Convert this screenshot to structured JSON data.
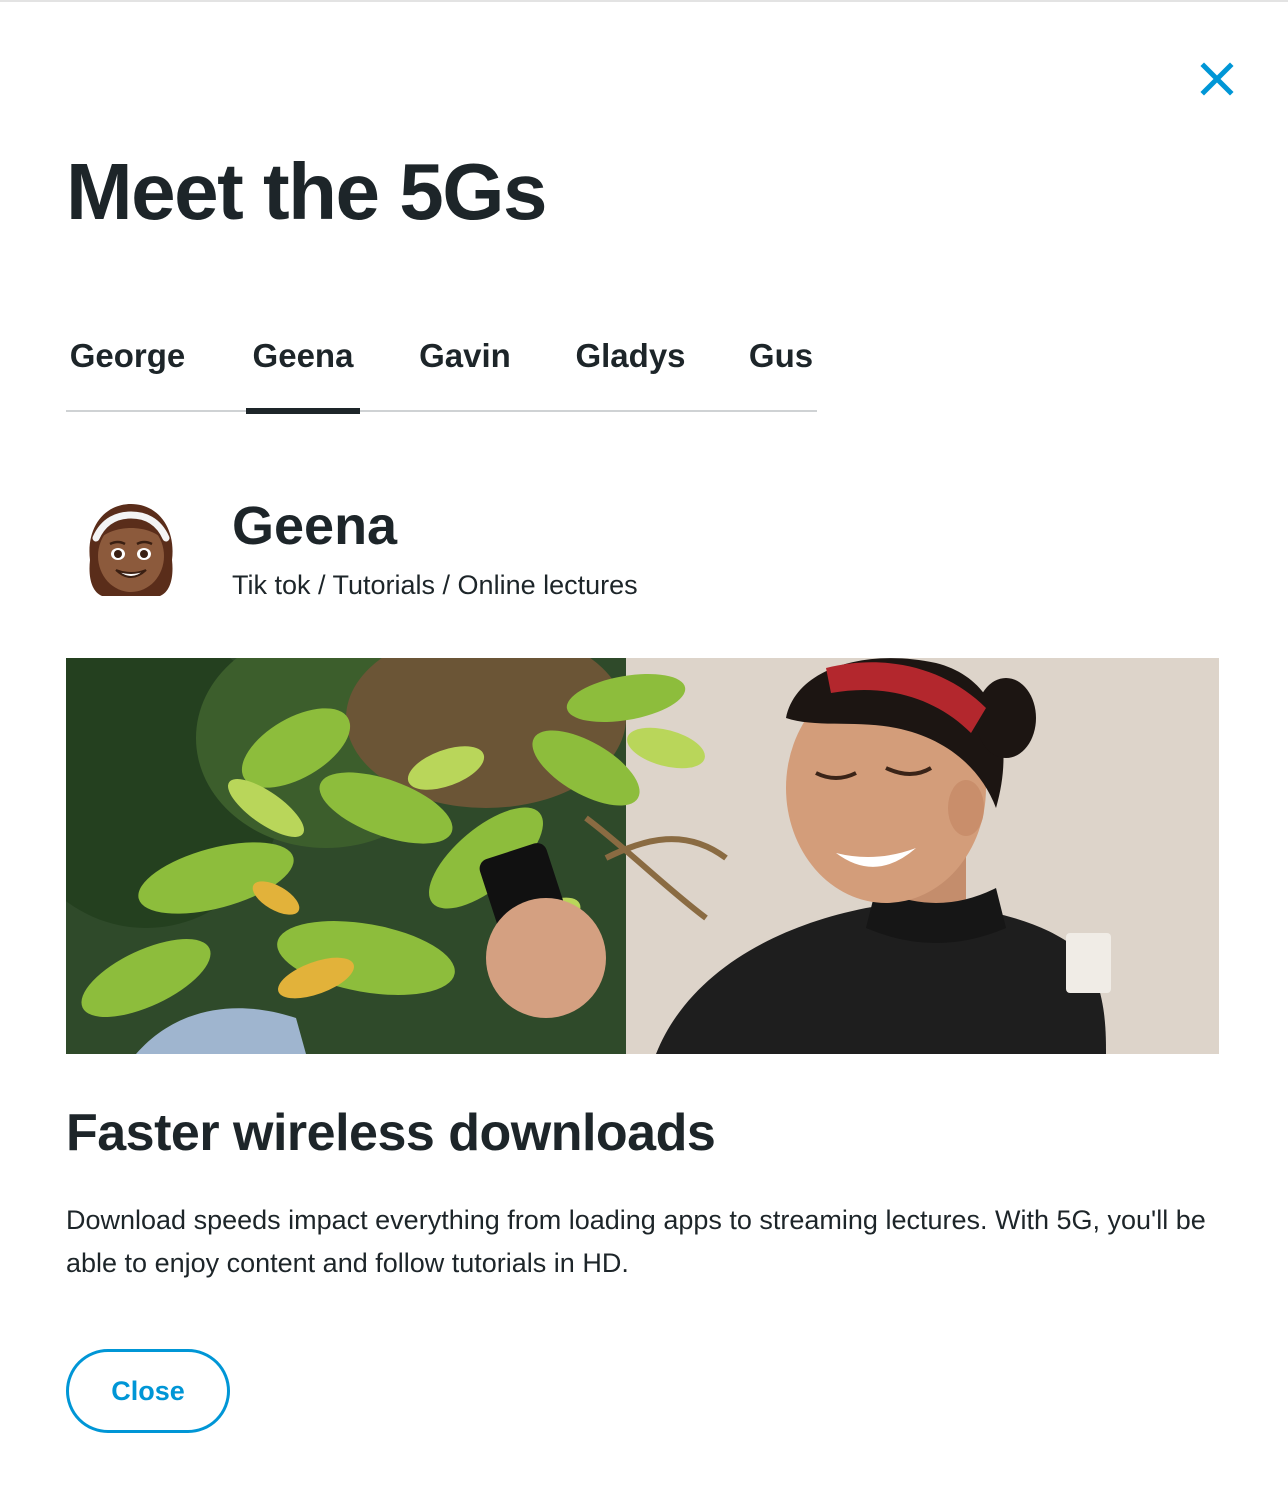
{
  "modal": {
    "title": "Meet the 5Gs",
    "close_icon": "close-icon",
    "accent_color": "#0096d6",
    "text_color": "#1d2529"
  },
  "tabs": [
    {
      "label": "George",
      "active": false
    },
    {
      "label": "Geena",
      "active": true
    },
    {
      "label": "Gavin",
      "active": false
    },
    {
      "label": "Gladys",
      "active": false
    },
    {
      "label": "Gus",
      "active": false
    }
  ],
  "profile": {
    "avatar_icon": "girl-emoji-icon",
    "name": "Geena",
    "tags": "Tik tok / Tutorials / Online lectures"
  },
  "hero_image": {
    "subject": "smiling-woman-with-phone-photo"
  },
  "feature": {
    "heading": "Faster wireless downloads",
    "body": "Download speeds impact everything from loading apps to streaming lectures. With 5G, you'll be able to enjoy content and follow tutorials in HD."
  },
  "footer": {
    "close_label": "Close"
  }
}
